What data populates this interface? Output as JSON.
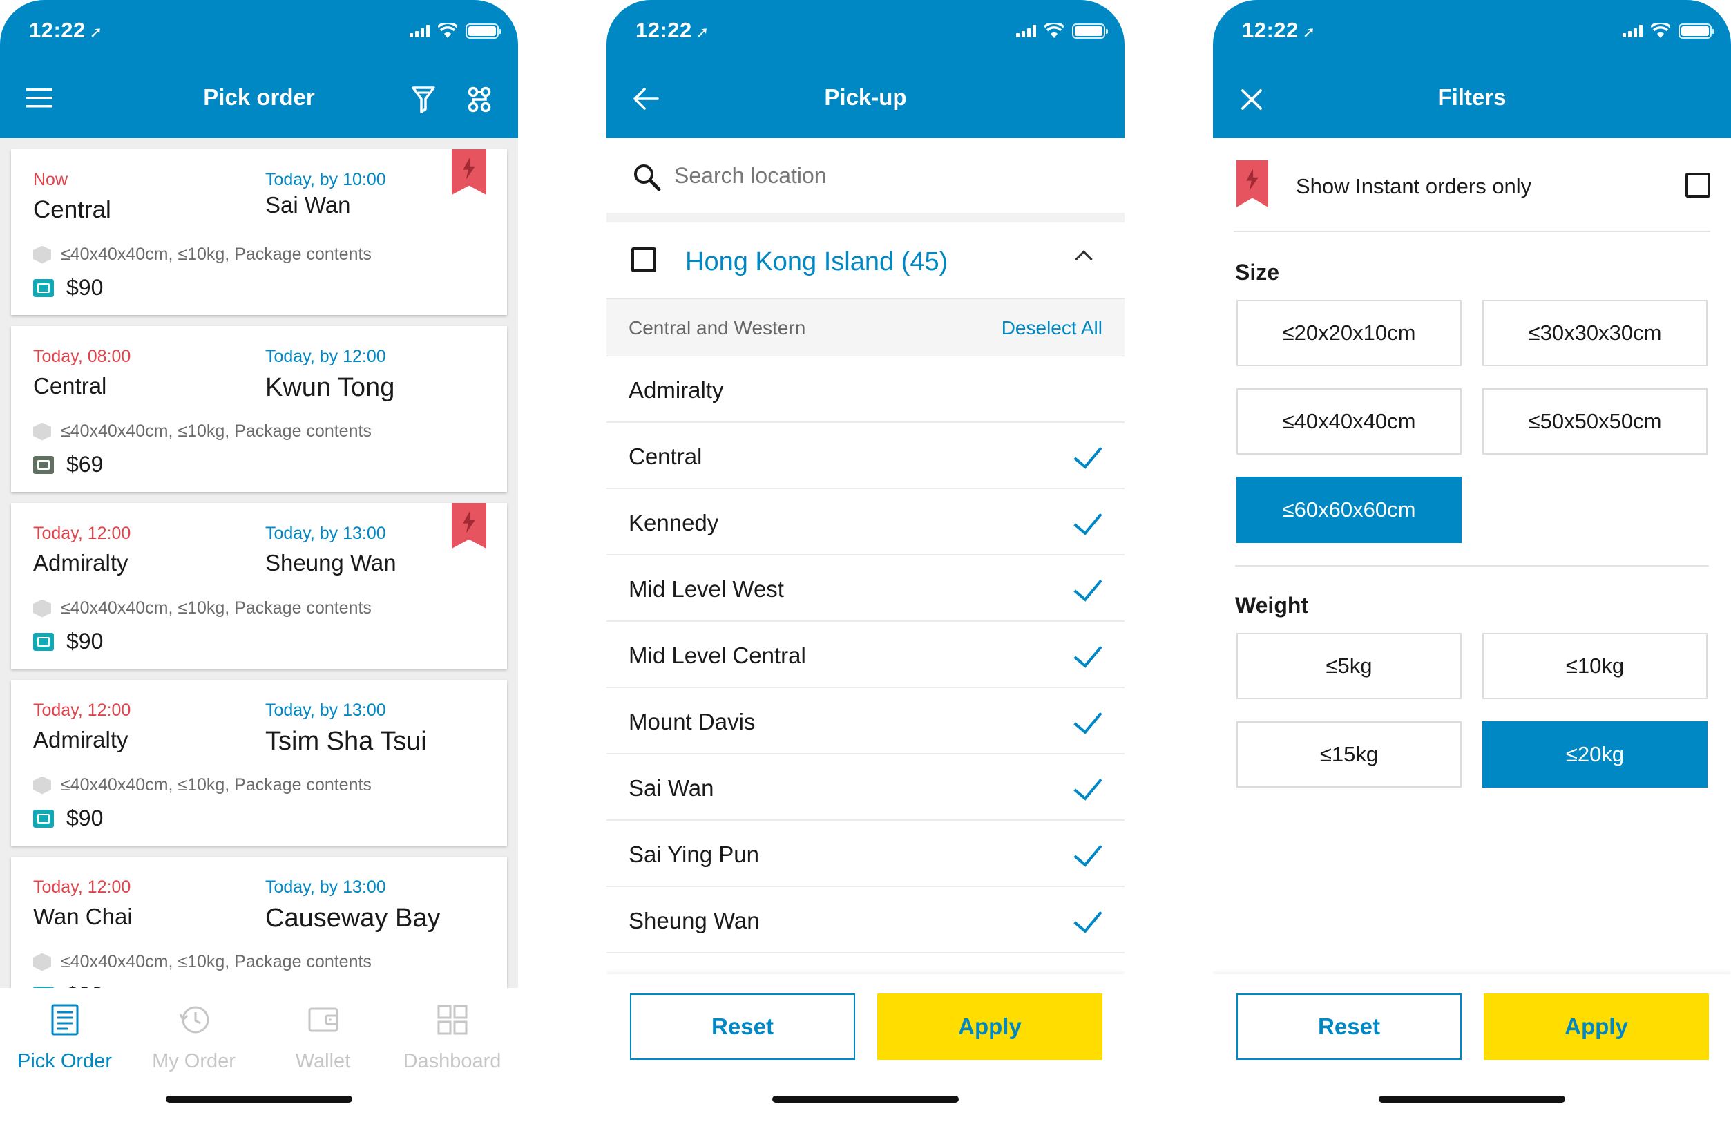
{
  "status": {
    "time": "12:22"
  },
  "screen1": {
    "title": "Pick order",
    "orders": [
      {
        "pickup_time": "Now",
        "deliver_by": "Today, by 10:00",
        "from": "Central",
        "to": "Sai Wan",
        "package": "≤40x40x40cm, ≤10kg, Package contents",
        "price": "$90",
        "instant": true
      },
      {
        "pickup_time": "Today, 08:00",
        "deliver_by": "Today, by 12:00",
        "from": "Central",
        "to": "Kwun Tong",
        "package": "≤40x40x40cm, ≤10kg, Package contents",
        "price": "$69",
        "instant": false
      },
      {
        "pickup_time": "Today, 12:00",
        "deliver_by": "Today, by 13:00",
        "from": "Admiralty",
        "to": "Sheung Wan",
        "package": "≤40x40x40cm, ≤10kg, Package contents",
        "price": "$90",
        "instant": true
      },
      {
        "pickup_time": "Today, 12:00",
        "deliver_by": "Today, by 13:00",
        "from": "Admiralty",
        "to": "Tsim Sha Tsui",
        "package": "≤40x40x40cm, ≤10kg, Package contents",
        "price": "$90",
        "instant": false
      },
      {
        "pickup_time": "Today, 12:00",
        "deliver_by": "Today, by 13:00",
        "from": "Wan Chai",
        "to": "Causeway Bay",
        "package": "≤40x40x40cm, ≤10kg, Package contents",
        "price": "$90",
        "instant": false
      }
    ],
    "tabs": [
      {
        "label": "Pick Order",
        "active": true
      },
      {
        "label": "My Order",
        "active": false
      },
      {
        "label": "Wallet",
        "active": false
      },
      {
        "label": "Dashboard",
        "active": false
      }
    ]
  },
  "screen2": {
    "title": "Pick-up",
    "search_placeholder": "Search location",
    "group": {
      "title": "Hong Kong Island (45)"
    },
    "subgroup": {
      "title": "Central and Western",
      "action": "Deselect All"
    },
    "locations": [
      {
        "name": "Admiralty",
        "checked": false
      },
      {
        "name": "Central",
        "checked": true
      },
      {
        "name": "Kennedy",
        "checked": true
      },
      {
        "name": "Mid Level West",
        "checked": true
      },
      {
        "name": "Mid Level Central",
        "checked": true
      },
      {
        "name": "Mount Davis",
        "checked": true
      },
      {
        "name": "Sai Wan",
        "checked": true
      },
      {
        "name": "Sai Ying Pun",
        "checked": true
      },
      {
        "name": "Sheung Wan",
        "checked": true
      }
    ],
    "reset_label": "Reset",
    "apply_label": "Apply"
  },
  "screen3": {
    "title": "Filters",
    "instant_label": "Show Instant orders only",
    "size_title": "Size",
    "sizes": [
      {
        "label": "≤20x20x10cm",
        "selected": false
      },
      {
        "label": "≤30x30x30cm",
        "selected": false
      },
      {
        "label": "≤40x40x40cm",
        "selected": false
      },
      {
        "label": "≤50x50x50cm",
        "selected": false
      },
      {
        "label": "≤60x60x60cm",
        "selected": true
      }
    ],
    "weight_title": "Weight",
    "weights": [
      {
        "label": "≤5kg",
        "selected": false
      },
      {
        "label": "≤10kg",
        "selected": false
      },
      {
        "label": "≤15kg",
        "selected": false
      },
      {
        "label": "≤20kg",
        "selected": true
      }
    ],
    "reset_label": "Reset",
    "apply_label": "Apply"
  },
  "colors": {
    "primary": "#0088c4",
    "urgent": "#e0434a",
    "apply": "#ffdd00",
    "instant_flag": "#e65460"
  },
  "icons": [
    "menu-icon",
    "filter-icon",
    "route-icon",
    "back-arrow-icon",
    "search-icon",
    "close-icon",
    "check-icon",
    "instant-bolt-icon",
    "package-icon",
    "cash-icon"
  ]
}
